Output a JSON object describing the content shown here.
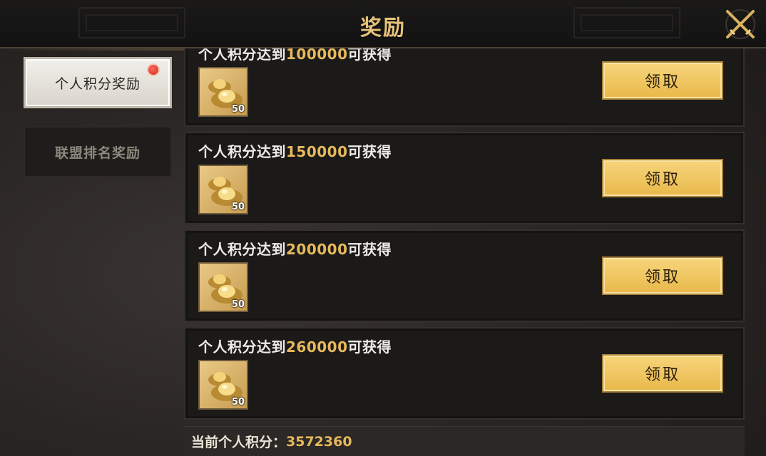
{
  "header": {
    "title": "奖励"
  },
  "tabs": [
    {
      "label": "个人积分奖励",
      "active": true,
      "has_notification": true
    },
    {
      "label": "联盟排名奖励",
      "active": false
    }
  ],
  "rewards": [
    {
      "desc_prefix": "个人积分达到",
      "threshold": "100000",
      "desc_suffix": "可获得",
      "item_icon": "gold-ingot-icon",
      "item_count": "50",
      "button_label": "领取"
    },
    {
      "desc_prefix": "个人积分达到",
      "threshold": "150000",
      "desc_suffix": "可获得",
      "item_icon": "gold-ingot-icon",
      "item_count": "50",
      "button_label": "领取"
    },
    {
      "desc_prefix": "个人积分达到",
      "threshold": "200000",
      "desc_suffix": "可获得",
      "item_icon": "gold-ingot-icon",
      "item_count": "50",
      "button_label": "领取"
    },
    {
      "desc_prefix": "个人积分达到",
      "threshold": "260000",
      "desc_suffix": "可获得",
      "item_icon": "gold-ingot-icon",
      "item_count": "50",
      "button_label": "领取"
    }
  ],
  "footer": {
    "label": "当前个人积分：",
    "value": "3572360"
  },
  "colors": {
    "accent_gold": "#e7b95b",
    "button_gold": "#f0c860",
    "notification_red": "#d6281d"
  }
}
